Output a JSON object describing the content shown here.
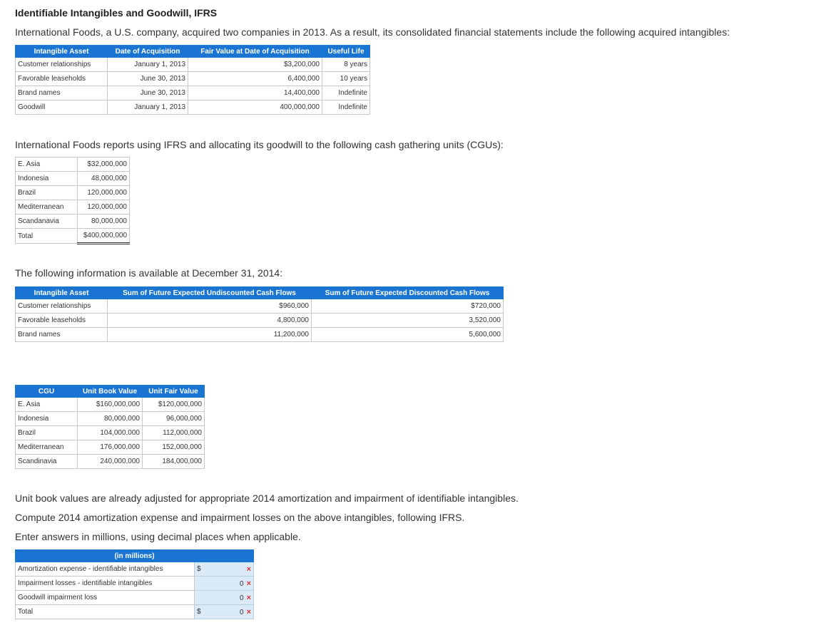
{
  "title": "Identifiable Intangibles and Goodwill, IFRS",
  "intro": "International Foods, a U.S. company, acquired two companies in 2013. As a result, its consolidated financial statements include the following acquired intangibles:",
  "table1": {
    "headers": [
      "Intangible Asset",
      "Date of Acquisition",
      "Fair Value at Date of Acquisition",
      "Useful Life"
    ],
    "rows": [
      [
        "Customer relationships",
        "January 1, 2013",
        "$3,200,000",
        "8 years"
      ],
      [
        "Favorable leaseholds",
        "June 30, 2013",
        "6,400,000",
        "10 years"
      ],
      [
        "Brand names",
        "June 30, 2013",
        "14,400,000",
        "Indefinite"
      ],
      [
        "Goodwill",
        "January 1, 2013",
        "400,000,000",
        "Indefinite"
      ]
    ]
  },
  "cgu_intro": "International Foods reports using IFRS and allocating its goodwill to the following cash gathering units (CGUs):",
  "table2": {
    "rows": [
      [
        "E. Asia",
        "$32,000,000"
      ],
      [
        "Indonesia",
        "48,000,000"
      ],
      [
        "Brazil",
        "120,000,000"
      ],
      [
        "Mediterranean",
        "120,000,000"
      ],
      [
        "Scandanavia",
        "80,000,000"
      ]
    ],
    "total_label": "Total",
    "total_value": "$400,000,000"
  },
  "dec_intro": "The following information is available at December 31, 2014:",
  "table3": {
    "headers": [
      "Intangible Asset",
      "Sum of Future Expected Undiscounted Cash Flows",
      "Sum of Future Expected Discounted Cash Flows"
    ],
    "rows": [
      [
        "Customer relationships",
        "$960,000",
        "$720,000"
      ],
      [
        "Favorable leaseholds",
        "4,800,000",
        "3,520,000"
      ],
      [
        "Brand names",
        "11,200,000",
        "5,600,000"
      ]
    ]
  },
  "table4": {
    "headers": [
      "CGU",
      "Unit Book Value",
      "Unit Fair Value"
    ],
    "rows": [
      [
        "E. Asia",
        "$160,000,000",
        "$120,000,000"
      ],
      [
        "Indonesia",
        "80,000,000",
        "96,000,000"
      ],
      [
        "Brazil",
        "104,000,000",
        "112,000,000"
      ],
      [
        "Mediterranean",
        "176,000,000",
        "152,000,000"
      ],
      [
        "Scandinavia",
        "240,000,000",
        "184,000,000"
      ]
    ]
  },
  "note1": "Unit book values are already adjusted for appropriate 2014 amortization and impairment of identifiable intangibles.",
  "note2": "Compute 2014 amortization expense and impairment losses on the above intangibles, following IFRS.",
  "note3": "Enter answers in millions, using decimal places when applicable.",
  "answer": {
    "header": "(in millions)",
    "dollar": "$",
    "x_mark": "×",
    "rows": [
      {
        "label": "Amortization expense - identifiable intangibles",
        "value": ""
      },
      {
        "label": "Impairment losses - identifiable intangibles",
        "value": "0"
      },
      {
        "label": "Goodwill impairment loss",
        "value": "0"
      },
      {
        "label": "Total",
        "value": "0"
      }
    ]
  }
}
